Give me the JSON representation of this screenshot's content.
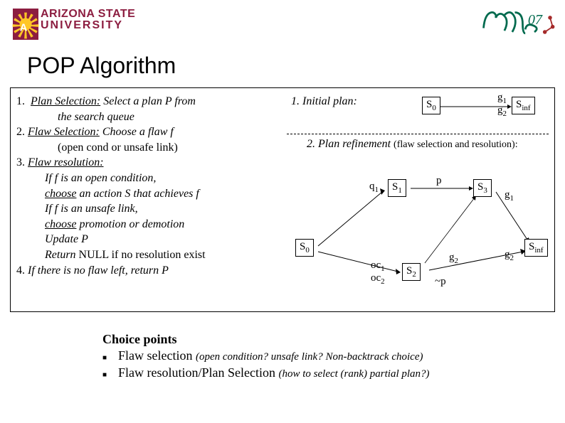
{
  "header": {
    "asu_line1": "ARIZONA STATE",
    "asu_line2": "UNIVERSITY",
    "right_logo_text": "icaps07"
  },
  "title": "POP Algorithm",
  "left": {
    "l1_num": "1.",
    "l1a": "Plan Selection:",
    "l1b": " Select a plan P from",
    "l1c": "the search queue",
    "l2_num": "2. ",
    "l2a": "Flaw Selection:",
    "l2b": " Choose a flaw f",
    "l2c": "(open cond or unsafe link)",
    "l3_num": "3. ",
    "l3a": "Flaw resolution:",
    "l3b": "If  f is an open condition,",
    "l3c1": "choose",
    "l3c2": " an action S that achieves f",
    "l3d": "If f is an unsafe link,",
    "l3e1": "choose",
    "l3e2": "  promotion or demotion",
    "l3f": "Update P",
    "l3g1": "Return",
    "l3g2": " NULL if no resolution exist",
    "l4_num": "4. ",
    "l4a": "If there is no flaw left, return P"
  },
  "right": {
    "initial": "1. Initial plan:",
    "s0": "S",
    "sub0": "0",
    "g1": "g",
    "g1sub": "1",
    "g2": "g",
    "g2sub": "2",
    "sinf": "S",
    "sinf_sub": "inf",
    "refine_a": "2. Plan refinement ",
    "refine_b": "(flaw selection and resolution):",
    "q1": "q",
    "q1s": "1",
    "s1": "S",
    "s1s": "1",
    "p": "p",
    "s3": "S",
    "s3s": "3",
    "g1b": "g",
    "g1bs": "1",
    "s0b": "S",
    "s0bs": "0",
    "oc1": "oc",
    "oc1s": "1",
    "oc2": "oc",
    "oc2s": "2",
    "s2": "S",
    "s2s": "2",
    "g2b": "g",
    "g2bs": "2",
    "np": "~p",
    "g2c": "g",
    "g2cs": "2",
    "sinfb": "S",
    "sinfbs": "inf"
  },
  "choice": {
    "title": "Choice points",
    "r1a": "Flaw selection ",
    "r1b": "(open condition? unsafe link? Non-backtrack choice)",
    "r2a": "Flaw resolution/Plan Selection ",
    "r2b": "(how to select (rank) partial plan?)"
  }
}
